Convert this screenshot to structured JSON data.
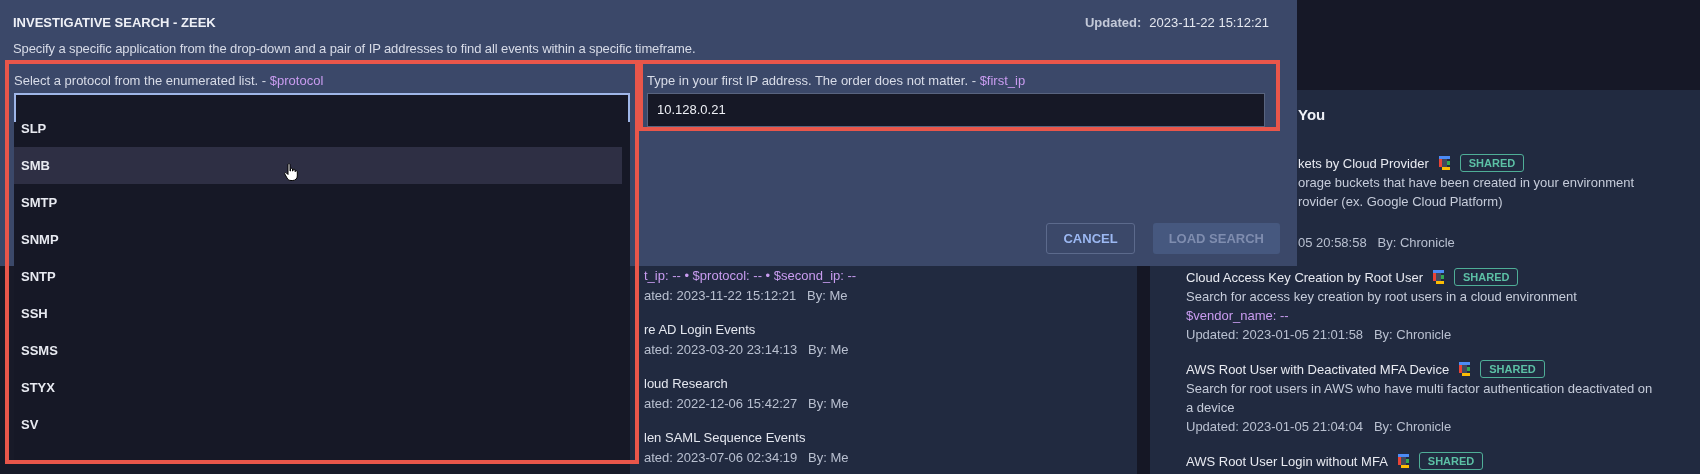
{
  "modal": {
    "title": "INVESTIGATIVE SEARCH - ZEEK",
    "updated_label": "Updated:",
    "updated_value": "2023-11-22 15:12:21",
    "description": "Specify a specific application from the drop-down and a pair of IP addresses to find all events within a specific timeframe.",
    "fields": [
      {
        "label": "Select a protocol from the enumerated list. - ",
        "variable": "$protocol",
        "focused": true
      },
      {
        "label": "Type in your first IP address. The order does not matter. - ",
        "variable": "$first_ip",
        "value": "10.128.0.21",
        "focused": false
      }
    ],
    "dropdown": {
      "options": [
        {
          "label": "SLP",
          "selected": false
        },
        {
          "label": "SMB",
          "selected": true
        },
        {
          "label": "SMTP",
          "selected": false
        },
        {
          "label": "SNMP",
          "selected": false
        },
        {
          "label": "SNTP",
          "selected": false
        },
        {
          "label": "SSH",
          "selected": false
        },
        {
          "label": "SSMS",
          "selected": false
        },
        {
          "label": "STYX",
          "selected": false
        },
        {
          "label": "SV",
          "selected": false
        }
      ]
    },
    "buttons": [
      {
        "label": "CANCEL",
        "kind": "outline",
        "disabled": false
      },
      {
        "label": "LOAD SEARCH",
        "kind": "filled",
        "disabled": true
      }
    ]
  },
  "recent_searches": {
    "items": [
      {
        "variables": "t_ip: -- • $protocol: -- • $second_ip: --",
        "meta": "ated: 2023-11-22 15:12:21   By: Me"
      },
      {
        "title": "re AD Login Events",
        "meta": "ated: 2023-03-20 23:14:13   By: Me"
      },
      {
        "title": "loud Research",
        "meta": "ated: 2022-12-06 15:42:27   By: Me"
      },
      {
        "title": "len SAML Sequence Events",
        "meta": "ated: 2023-07-06 02:34:19   By: Me"
      }
    ]
  },
  "suggested": {
    "heading": "You",
    "items": [
      {
        "clipped": true,
        "title": "kets by Cloud Provider",
        "badge": "SHARED",
        "description_lines": [
          "orage buckets that have been created in your environment",
          "rovider (ex. Google Cloud Platform)"
        ],
        "meta": "05 20:58:58   By: Chronicle"
      },
      {
        "clipped": false,
        "title": "Cloud Access Key Creation by Root User",
        "badge": "SHARED",
        "description_lines": [
          "Search for access key creation by root users in a cloud environment"
        ],
        "variables": "$vendor_name: --",
        "meta": "Updated: 2023-01-05 21:01:58   By: Chronicle"
      },
      {
        "clipped": false,
        "title": "AWS Root User with Deactivated MFA Device",
        "badge": "SHARED",
        "description_lines": [
          "Search for root users in AWS who have multi factor authentication deactivated on",
          "a device"
        ],
        "meta": "Updated: 2023-01-05 21:04:04   By: Chronicle"
      },
      {
        "clipped": false,
        "title": "AWS Root User Login without MFA",
        "badge": "SHARED"
      }
    ]
  }
}
